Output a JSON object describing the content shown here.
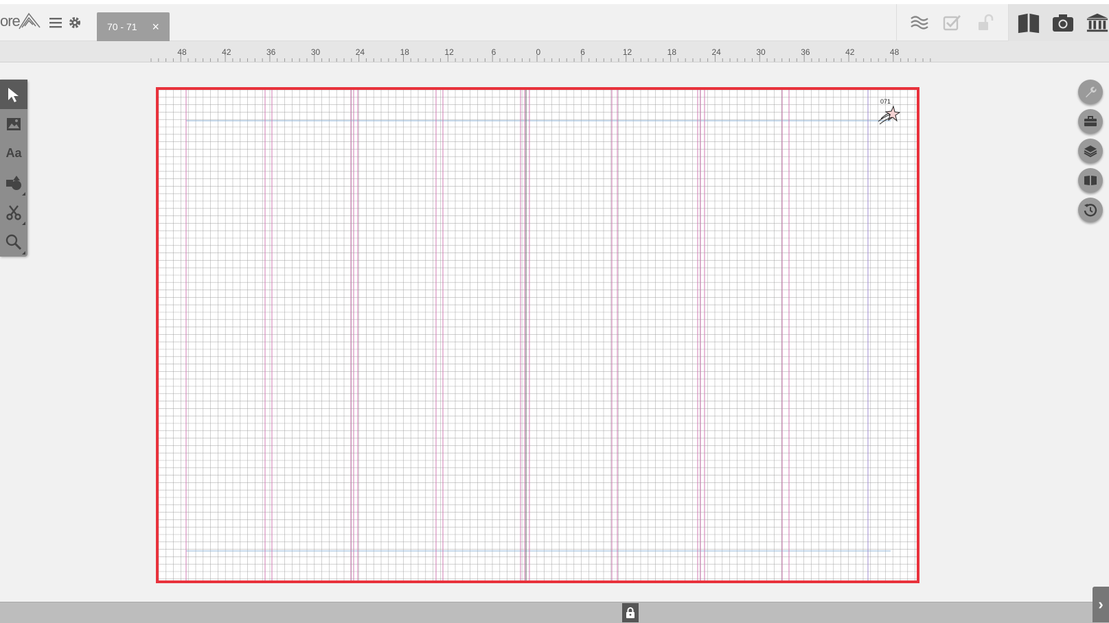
{
  "app": {
    "logo_text": "ore"
  },
  "tab": {
    "label": "70 - 71",
    "close_symbol": "×"
  },
  "ruler": {
    "labels": [
      "48",
      "42",
      "36",
      "30",
      "24",
      "18",
      "12",
      "6",
      "0",
      "6",
      "12",
      "18",
      "24",
      "30",
      "36",
      "42",
      "48"
    ]
  },
  "left_tools": [
    {
      "name": "select-tool",
      "icon": "pointer-icon",
      "active": true
    },
    {
      "name": "image-tool",
      "icon": "image-icon",
      "active": false
    },
    {
      "name": "text-tool",
      "icon": "text-icon",
      "label": "Aa",
      "active": false
    },
    {
      "name": "shape-tool",
      "icon": "shapes-icon",
      "active": false
    },
    {
      "name": "cut-tool",
      "icon": "scissors-icon",
      "active": false
    },
    {
      "name": "zoom-tool",
      "icon": "zoom-icon",
      "active": false
    }
  ],
  "right_rail": [
    {
      "name": "wrench-button",
      "icon": "wrench-icon"
    },
    {
      "name": "toolbox-button",
      "icon": "briefcase-icon"
    },
    {
      "name": "layers-button",
      "icon": "layers-icon"
    },
    {
      "name": "book-view-button",
      "icon": "book-icon"
    },
    {
      "name": "history-button",
      "icon": "history-icon"
    }
  ],
  "top_right_tools": [
    {
      "name": "wave-button",
      "icon": "waves-icon"
    },
    {
      "name": "approve-button",
      "icon": "checkbox-icon"
    },
    {
      "name": "unlock-button",
      "icon": "unlock-icon"
    },
    {
      "name": "book-button",
      "icon": "open-book-icon"
    },
    {
      "name": "camera-button",
      "icon": "camera-icon"
    },
    {
      "name": "library-button",
      "icon": "library-icon"
    }
  ],
  "canvas": {
    "folio_text": "071",
    "border_color": "#e8323c",
    "grid_color": "#9a9a9a",
    "guide_color": "#d07bb3",
    "margin_guide_color": "#8fb6d9"
  },
  "colors": {
    "tab_bg": "#9e9e9e",
    "toolbar_bg": "#8d8d8d"
  }
}
